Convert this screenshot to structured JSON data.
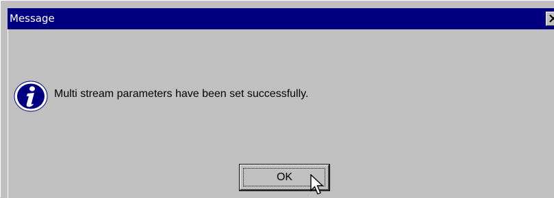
{
  "window": {
    "title": "Message",
    "close_glyph": "✕",
    "colors": {
      "titlebar": "#000080",
      "face": "#c0c0c0",
      "title_text": "#ffffff"
    }
  },
  "message": {
    "icon": "info-icon",
    "text": "Multi stream parameters have been set successfully."
  },
  "buttons": {
    "ok_label": "OK"
  },
  "cursor": {
    "icon": "pointer-arrow-icon"
  }
}
